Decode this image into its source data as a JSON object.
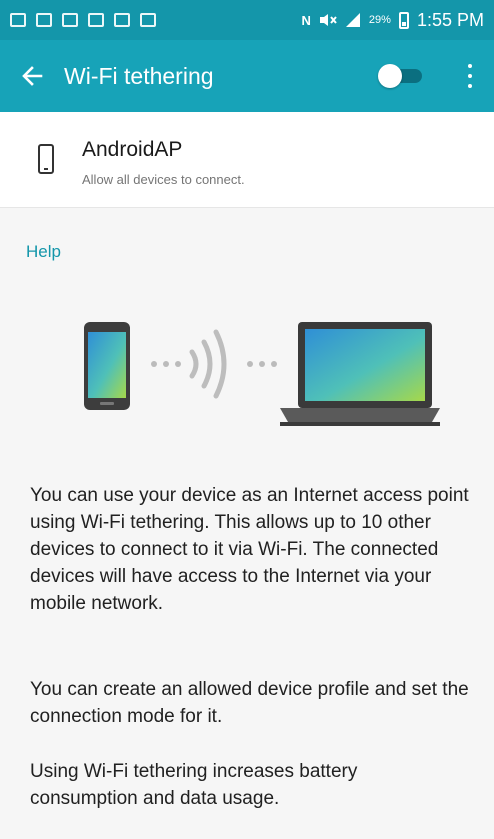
{
  "status_bar": {
    "battery_percent": "29%",
    "time": "1:55 PM",
    "nfc_label": "N"
  },
  "app_bar": {
    "title": "Wi-Fi tethering",
    "toggle_on": false
  },
  "network": {
    "name": "AndroidAP",
    "subtitle": "Allow all devices to connect."
  },
  "help_link": "Help",
  "description": {
    "paragraph1": "You can use your device as an Internet access point using Wi-Fi tethering. This allows up to 10 other devices to connect to it via Wi-Fi. The connected devices will have access to the Internet via your mobile network.",
    "paragraph2": "You can create an allowed device profile and set the connection mode for it.",
    "paragraph3": "Using Wi-Fi tethering increases battery consumption and data usage."
  },
  "colors": {
    "status_bar": "#1496aa",
    "app_bar": "#17a3b8",
    "accent": "#1496aa"
  }
}
